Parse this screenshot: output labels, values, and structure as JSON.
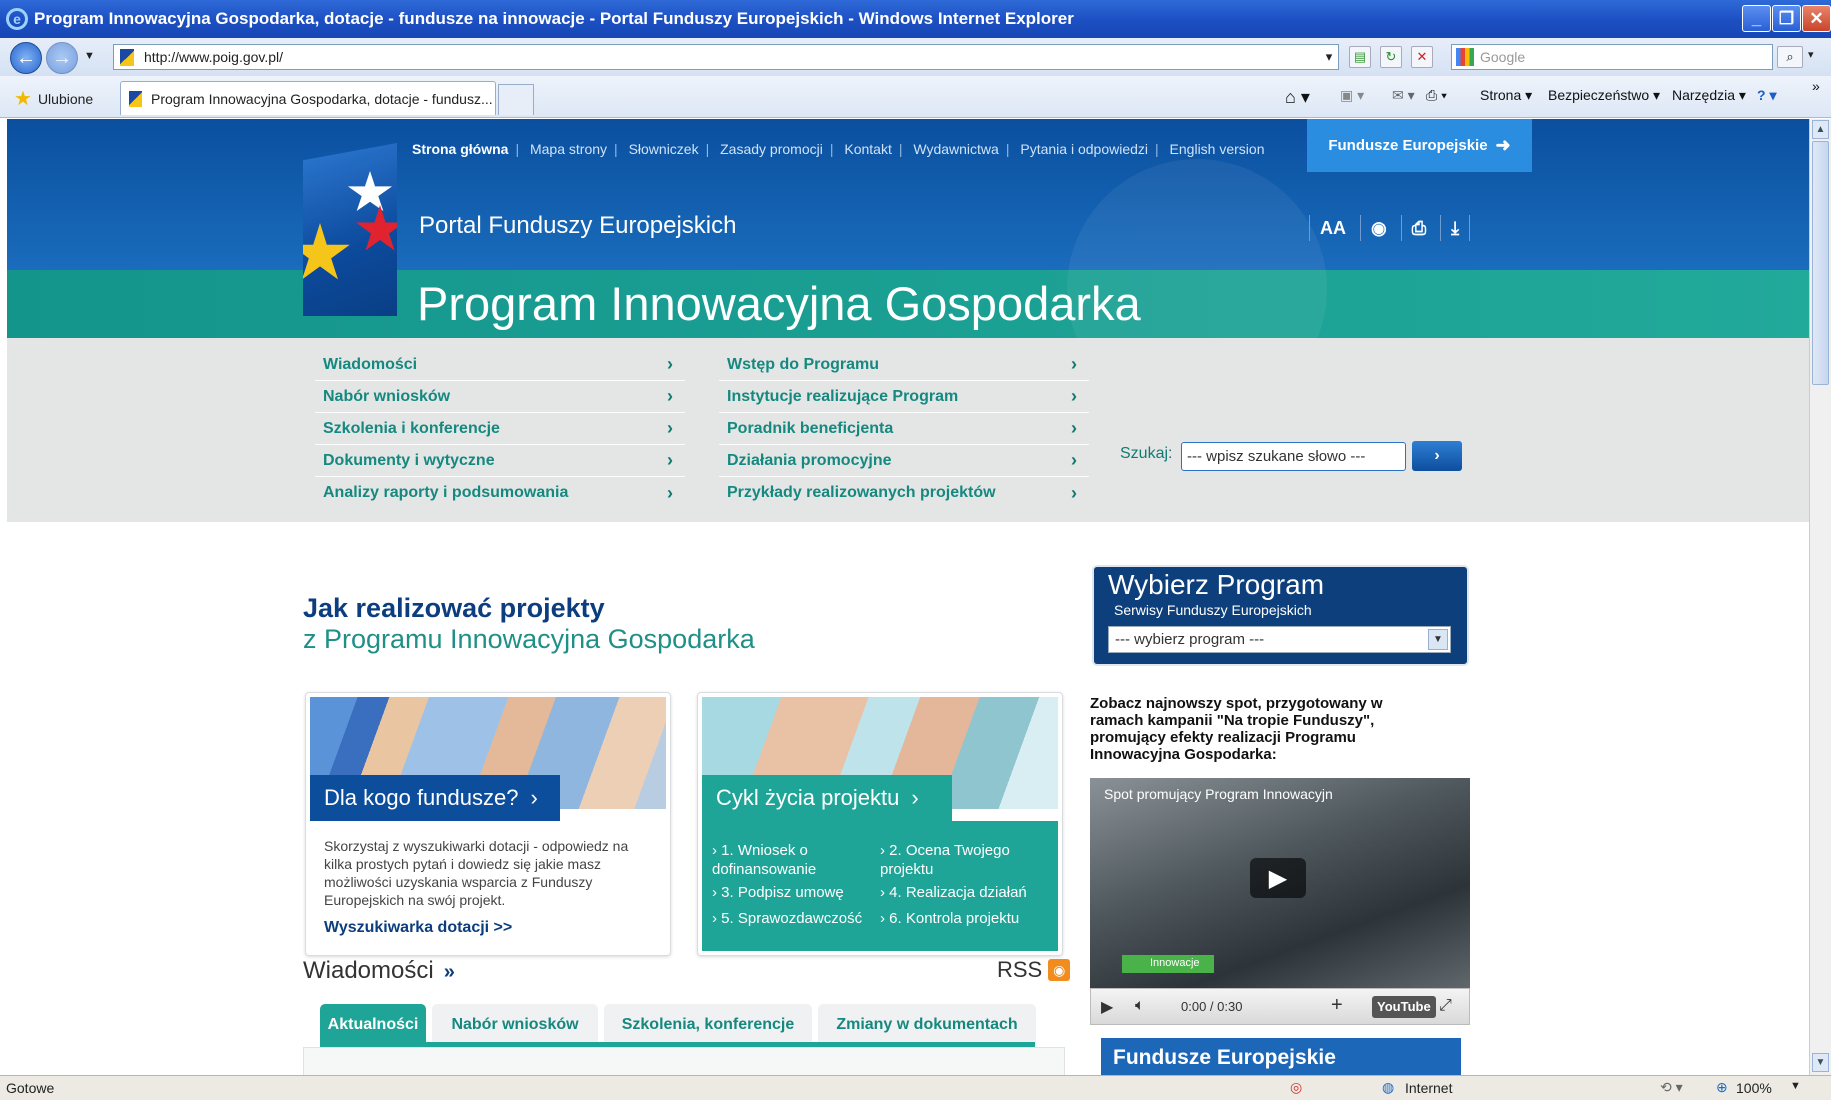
{
  "window": {
    "title": "Program Innowacyjna Gospodarka, dotacje - fundusze na innowacje - Portal Funduszy Europejskich - Windows Internet Explorer"
  },
  "browser": {
    "address": "http://www.poig.gov.pl/",
    "search_placeholder": "Google",
    "favorites_label": "Ulubione",
    "tab_title": "Program Innowacyjna Gospodarka, dotacje - fundusz...",
    "commands": [
      "Strona",
      "Bezpieczeństwo",
      "Narzędzia"
    ],
    "status_text": "Gotowe",
    "zone": "Internet",
    "zoom": "100%"
  },
  "site": {
    "topnav": [
      "Strona główna",
      "Mapa strony",
      "Słowniczek",
      "Zasady promocji",
      "Kontakt",
      "Wydawnictwa",
      "Pytania i odpowiedzi",
      "English version"
    ],
    "fe_button": "Fundusze Europejskie",
    "portal_name": "Portal Funduszy Europejskich",
    "program_title": "Program Innowacyjna Gospodarka",
    "font_tool": "AA",
    "menu_left": [
      "Wiadomości",
      "Nabór wniosków",
      "Szkolenia i konferencje",
      "Dokumenty i wytyczne",
      "Analizy raporty i podsumowania"
    ],
    "menu_right": [
      "Wstęp do Programu",
      "Instytucje realizujące Program",
      "Poradnik beneficjenta",
      "Działania promocyjne",
      "Przykłady realizowanych projektów"
    ],
    "search_label": "Szukaj:",
    "search_value": "--- wpisz szukane słowo ---"
  },
  "main": {
    "heading": "Jak realizować projekty",
    "subheading": "z Programu Innowacyjna Gospodarka",
    "card1": {
      "title": "Dla kogo fundusze?",
      "text": "Skorzystaj z wyszukiwarki dotacji - odpowiedz na kilka prostych pytań i dowiedz się jakie masz możliwości uzyskania wsparcia z Funduszy Europejskich na swój projekt.",
      "link": "Wyszukiwarka dotacji >>"
    },
    "card2": {
      "title": "Cykl życia projektu",
      "steps": [
        "1. Wniosek o dofinansowanie",
        "2. Ocena Twojego projektu",
        "3. Podpisz umowę",
        "4. Realizacja działań",
        "5. Sprawozdawczość",
        "6. Kontrola projektu"
      ]
    },
    "news": {
      "title": "Wiadomości",
      "more": "»",
      "rss": "RSS",
      "tabs": [
        "Aktualności",
        "Nabór wniosków",
        "Szkolenia, konferencje",
        "Zmiany w dokumentach"
      ]
    }
  },
  "sidebar": {
    "program_box": {
      "title": "Wybierz Program",
      "subtitle": "Serwisy Funduszy Europejskich",
      "select_value": "--- wybierz program ---"
    },
    "promo_text": "Zobacz najnowszy spot, przygotowany w ramach kampanii \"Na tropie Funduszy\", promujący efekty realizacji Programu Innowacyjna Gospodarka:",
    "video": {
      "title": "Spot promujący Program Innowacyjn",
      "time": "0:00 / 0:30",
      "badge": "Innowacje",
      "youtube": "YouTube"
    },
    "banner": "Fundusze Europejskie"
  },
  "colors": {
    "header_blue": "#0b4f9f",
    "teal": "#1fa597",
    "navy": "#0c3d7e"
  }
}
